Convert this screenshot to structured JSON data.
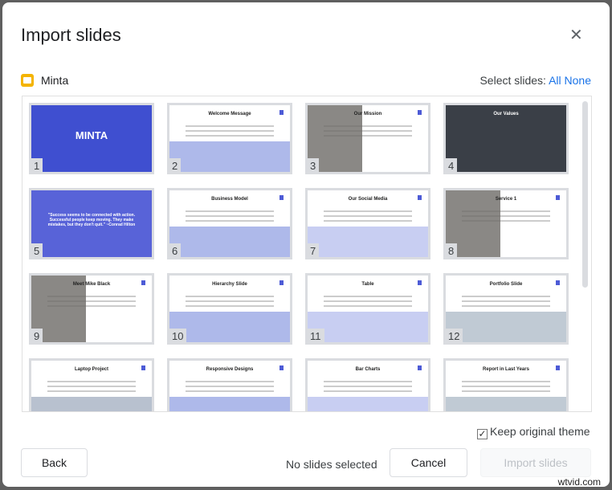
{
  "dialog": {
    "title": "Import slides",
    "close_icon": "close-icon"
  },
  "source": {
    "name": "Minta",
    "icon": "google-slides-icon",
    "icon_color": "#f4b400"
  },
  "select": {
    "label": "Select slides:",
    "all": "All",
    "none": "None"
  },
  "slides": [
    {
      "n": "1",
      "title": "MINTA",
      "bg": "#3f4fd0",
      "dark": true
    },
    {
      "n": "2",
      "title": "Welcome Message",
      "bg": "#ffffff"
    },
    {
      "n": "3",
      "title": "Our Mission",
      "bg": "#ffffff"
    },
    {
      "n": "4",
      "title": "Our Values",
      "bg": "#3a3f47",
      "dark": true
    },
    {
      "n": "5",
      "title": "\"Success seems to be connected with action. Successful people keep moving. They make mistakes, but they don't quit.\" ~Conrad Hilton",
      "bg": "#5863d8",
      "dark": true
    },
    {
      "n": "6",
      "title": "Business Model",
      "bg": "#ffffff"
    },
    {
      "n": "7",
      "title": "Our Social Media",
      "bg": "#ffffff"
    },
    {
      "n": "8",
      "title": "Service 1",
      "bg": "#ffffff"
    },
    {
      "n": "9",
      "title": "Meet Mike Black",
      "bg": "#ffffff"
    },
    {
      "n": "10",
      "title": "Hierarchy Slide",
      "bg": "#ffffff"
    },
    {
      "n": "11",
      "title": "Table",
      "bg": "#ffffff"
    },
    {
      "n": "12",
      "title": "Portfolio Slide",
      "bg": "#ffffff"
    },
    {
      "n": "",
      "title": "Laptop Project",
      "bg": "#ffffff"
    },
    {
      "n": "",
      "title": "Responsive Designs",
      "bg": "#ffffff"
    },
    {
      "n": "",
      "title": "Bar Charts",
      "bg": "#ffffff"
    },
    {
      "n": "",
      "title": "Report in Last Years",
      "bg": "#ffffff"
    }
  ],
  "options": {
    "keep_theme": "Keep original theme",
    "keep_theme_checked": true
  },
  "footer": {
    "back": "Back",
    "status": "No slides selected",
    "cancel": "Cancel",
    "import": "Import slides"
  },
  "watermark": "wtvid.com"
}
